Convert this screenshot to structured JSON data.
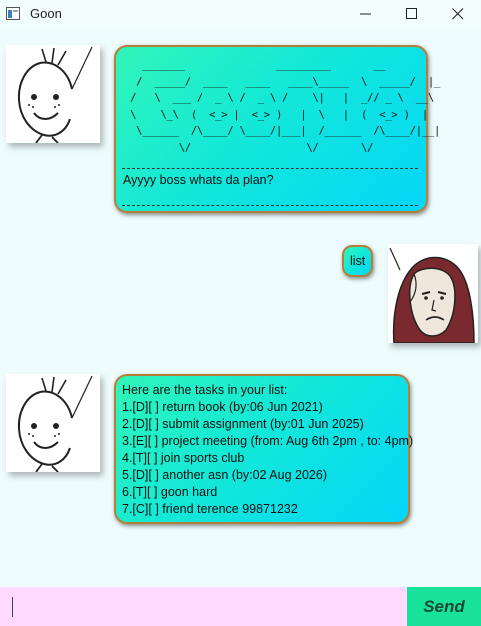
{
  "window": {
    "title": "Goon"
  },
  "conversation": {
    "greeting": {
      "logo_ascii": "   _______               _________       __\n  /  _____/  ____   ____   ____\\_____  \\  _____/  |_\n /   \\  ___ /  _ \\ /  _ \\ /    \\|   |  _// _ \\  __\\\n \\    \\_\\  (  <_> |  <_> )   |  \\   |  (  <_> )  |\n  \\______  /\\____/ \\____/|___|  /______  /\\____/|__|\n         \\/                   \\/       \\/",
      "message": "Ayyyy boss whats da plan?"
    },
    "user_message": "list",
    "task_reply": {
      "header": "Here are the tasks in your list:",
      "tasks": [
        "1.[D][ ] return book (by:06 Jun 2021)",
        "2.[D][ ] submit assignment (by:01 Jun 2025)",
        "3.[E][ ] project meeting (from: Aug 6th 2pm , to: 4pm)",
        "4.[T][ ] join sports club",
        "5.[D][ ] another asn (by:02 Aug 2026)",
        "6.[T][ ] goon hard",
        "7.[C][ ] friend terence 99871232"
      ]
    }
  },
  "input": {
    "value": "",
    "send_label": "Send"
  },
  "colors": {
    "background": "#eefcfd",
    "bubble_gradient": [
      "#31f5b9",
      "#05d6f8"
    ],
    "bubble_border": "#b57f37",
    "input_background": "#ffd9ff",
    "send_button": "#19e39a"
  }
}
